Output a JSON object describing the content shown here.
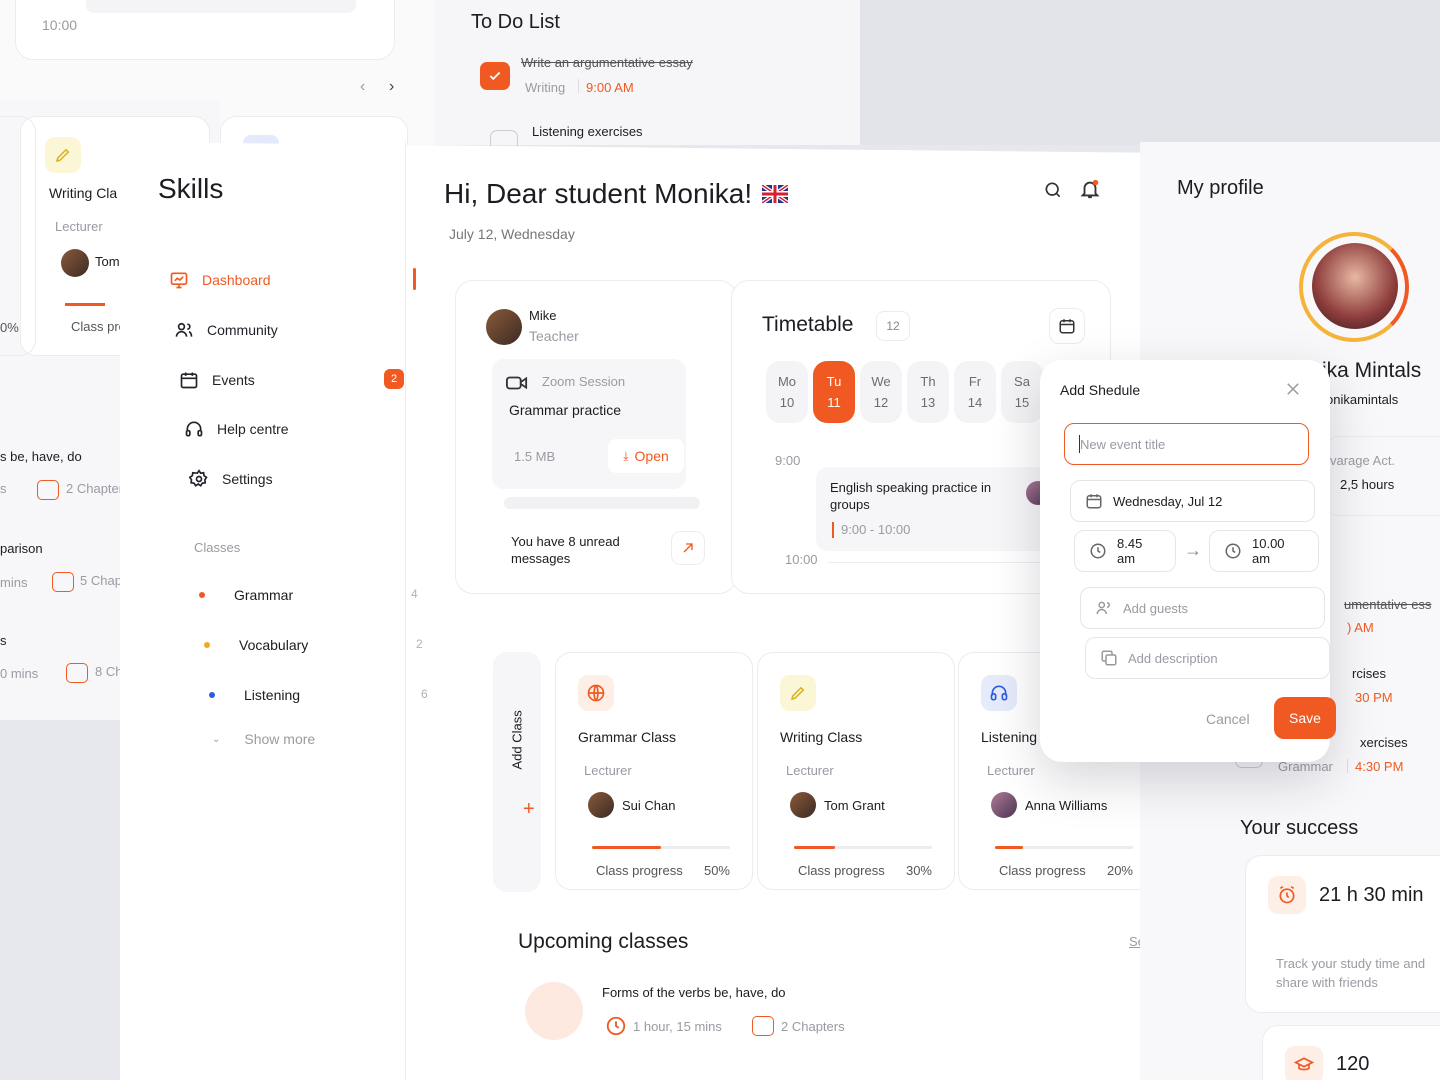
{
  "accent": "#f05a22",
  "bg_left": {
    "time": "10:00",
    "writing_class": "Writing Cla",
    "lecturer": "Lecturer",
    "lecturer_name": "Tom G",
    "class_prog": "Class prog",
    "percent": "0%",
    "items": [
      {
        "title": "s be, have, do",
        "meta": "s",
        "chapters": "2 Chapters"
      },
      {
        "title": "parison",
        "meta": "mins",
        "chapters": "5 Chapters"
      },
      {
        "title": "s",
        "meta": "0 mins",
        "chapters": "8 Chapters"
      }
    ]
  },
  "todo": {
    "title": "To Do List",
    "item1": "Write an argumentative essay",
    "item1_cat": "Writing",
    "item1_time": "9:00 AM",
    "item2": "Listening exercises"
  },
  "sidebar": {
    "brand": "Skills",
    "nav": [
      {
        "label": "Dashboard",
        "icon": "chart-icon"
      },
      {
        "label": "Community",
        "icon": "users-icon"
      },
      {
        "label": "Events",
        "icon": "calendar-icon",
        "badge": "2"
      },
      {
        "label": "Help centre",
        "icon": "headphones-icon"
      },
      {
        "label": "Settings",
        "icon": "gear-icon"
      }
    ],
    "classes_heading": "Classes",
    "classes": [
      {
        "label": "Grammar",
        "count": "4",
        "color": "#f05a22"
      },
      {
        "label": "Vocabulary",
        "count": "2",
        "color": "#f5a623"
      },
      {
        "label": "Listening",
        "count": "6",
        "color": "#2d5be3"
      }
    ],
    "show_more": "Show more"
  },
  "header": {
    "greeting": "Hi, Dear student Monika!",
    "date": "July 12, Wednesday"
  },
  "message_card": {
    "name": "Mike",
    "role": "Teacher",
    "session_type": "Zoom Session",
    "session_title": "Grammar practice",
    "file_size": "1.5 MB",
    "open_label": "Open",
    "unread": "You have 8 unread messages"
  },
  "timetable": {
    "title": "Timetable",
    "count": "12",
    "days": [
      {
        "d": "Mo",
        "n": "10"
      },
      {
        "d": "Tu",
        "n": "11",
        "active": true
      },
      {
        "d": "We",
        "n": "12"
      },
      {
        "d": "Th",
        "n": "13"
      },
      {
        "d": "Fr",
        "n": "14"
      },
      {
        "d": "Sa",
        "n": "15"
      }
    ],
    "time1": "9:00",
    "time2": "10:00",
    "event_title": "English speaking practice in groups",
    "event_time": "9:00 - 10:00"
  },
  "classes": {
    "add_class": "Add Class",
    "lecturer_label": "Lecturer",
    "progress_label": "Class progress",
    "cards": [
      {
        "title": "Grammar Class",
        "lecturer": "Sui Chan",
        "progress": "50%",
        "fill": 0.5,
        "icon": "globe-icon"
      },
      {
        "title": "Writing Class",
        "lecturer": "Tom Grant",
        "progress": "30%",
        "fill": 0.3,
        "icon": "pen-icon"
      },
      {
        "title": "Listening Clas",
        "lecturer": "Anna Williams",
        "progress": "20%",
        "fill": 0.2,
        "icon": "headset-icon"
      }
    ]
  },
  "upcoming": {
    "title": "Upcoming classes",
    "see_all": "See All",
    "item_title": "Forms of the verbs be, have, do",
    "duration": "1 hour, 15 mins",
    "chapters": "2 Chapters"
  },
  "modal": {
    "title": "Add Shedule",
    "placeholder": "New event title",
    "date": "Wednesday, Jul 12",
    "start": "8.45 am",
    "end": "10.00 am",
    "guests": "Add guests",
    "description": "Add description",
    "cancel": "Cancel",
    "save": "Save"
  },
  "profile": {
    "title": "My profile",
    "name": "ika Mintals",
    "handle": "onikamintals",
    "avg_label": "varage Act.",
    "avg_value": "2,5 hours",
    "todo_fragments": [
      {
        "text": "umentative ess"
      },
      {
        "text": ") AM"
      },
      {
        "text": "rcises"
      },
      {
        "text": "30 PM"
      },
      {
        "text": "xercises"
      }
    ],
    "grammar_cat": "Grammar",
    "grammar_time": "4:30 PM",
    "success_title": "Your success",
    "study_time": "21 h 30 min",
    "study_caption": "Track your study time and share with friends",
    "score": "120"
  }
}
